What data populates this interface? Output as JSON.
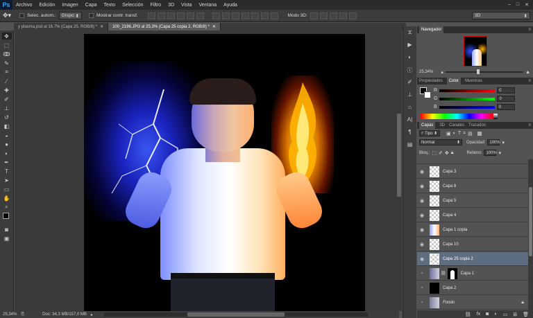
{
  "menubar": {
    "logo": "Ps",
    "items": [
      "Archivo",
      "Edición",
      "Imagen",
      "Capa",
      "Texto",
      "Selección",
      "Filtro",
      "3D",
      "Vista",
      "Ventana",
      "Ayuda"
    ]
  },
  "options": {
    "auto_select_label": "Selec. autom.:",
    "auto_select_value": "Grupo",
    "show_transform_label": "Mostrar contr. transf.",
    "mode3d_label": "Modo 3D:",
    "workspace": "3D"
  },
  "tabs": [
    {
      "label": "y plasma.psd al 16,7% (Capa 25, RGB/8) *",
      "active": false
    },
    {
      "label": "100_2196.JPG al 25,3% (Capa 25 copia 2, RGB/8) *",
      "active": true
    }
  ],
  "status": {
    "zoom": "25,34%",
    "doc": "Doc: 34,3 MB/157,0 MB"
  },
  "navigator": {
    "title": "Navegador",
    "zoom": "25,34%"
  },
  "color_panel": {
    "tabs": [
      "Propiedades",
      "Color",
      "Muestras"
    ],
    "active_tab": "Color",
    "channels": [
      {
        "label": "R",
        "value": "0"
      },
      {
        "label": "G",
        "value": "0"
      },
      {
        "label": "B",
        "value": "0"
      }
    ]
  },
  "layers_panel": {
    "tabs": [
      "Capas",
      "3D",
      "Canales",
      "Trazados"
    ],
    "active_tab": "Capas",
    "filter": "Tipo",
    "blend_mode": "Normal",
    "opacity_label": "Opacidad:",
    "opacity": "100%",
    "lock_label": "Bloq.:",
    "fill_label": "Relleno:",
    "fill": "100%",
    "layers": [
      {
        "name": "Capa 3",
        "selected": false,
        "visible": true,
        "thumb": "transparent"
      },
      {
        "name": "Capa 6",
        "selected": false,
        "visible": true,
        "thumb": "transparent"
      },
      {
        "name": "Capa 5",
        "selected": false,
        "visible": true,
        "thumb": "transparent"
      },
      {
        "name": "Capa 4",
        "selected": false,
        "visible": true,
        "thumb": "transparent"
      },
      {
        "name": "Capa 1 copia",
        "selected": false,
        "visible": true,
        "thumb": "person"
      },
      {
        "name": "Capa 10",
        "selected": false,
        "visible": true,
        "thumb": "transparent"
      },
      {
        "name": "Capa 25 copia 2",
        "selected": true,
        "visible": true,
        "thumb": "transparent"
      },
      {
        "name": "Capa 1",
        "selected": false,
        "visible": false,
        "thumb": "mask"
      },
      {
        "name": "Capa 2",
        "selected": false,
        "visible": false,
        "thumb": "black"
      },
      {
        "name": "Fondo",
        "selected": false,
        "visible": false,
        "thumb": "person"
      }
    ]
  },
  "colors": {
    "accent": "#31a8ff",
    "selected_layer": "#5f6d80"
  }
}
